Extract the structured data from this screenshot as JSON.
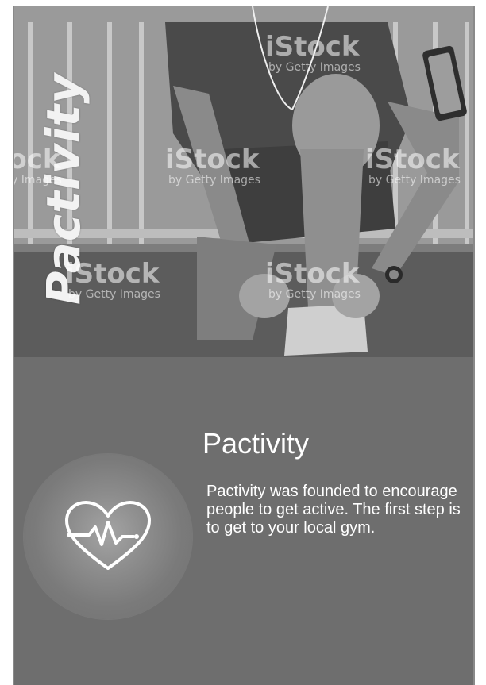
{
  "hero": {
    "brand_vertical": "Pactivity",
    "watermark": {
      "main": "iStock",
      "sub": "by Getty Images"
    }
  },
  "content": {
    "title": "Pactivity",
    "description": "Pactivity was founded to encourage people to get active. The first step is to get to your local gym."
  },
  "icons": {
    "heart": "heart-pulse-icon"
  },
  "colors": {
    "background": "#6e6e6e",
    "text": "#ffffff"
  }
}
